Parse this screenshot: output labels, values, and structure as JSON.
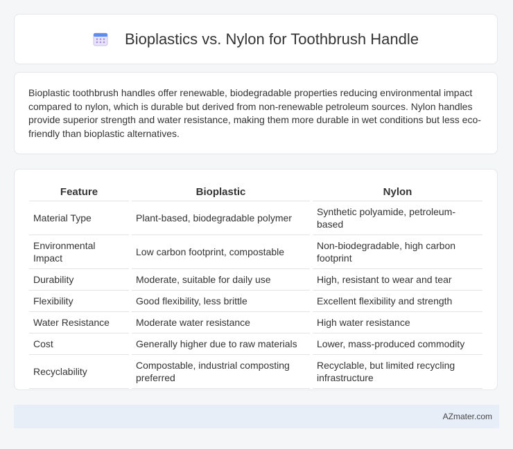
{
  "header": {
    "title": "Bioplastics vs. Nylon for Toothbrush Handle",
    "icon": "calendar-icon"
  },
  "summary": {
    "text": "Bioplastic toothbrush handles offer renewable, biodegradable properties reducing environmental impact compared to nylon, which is durable but derived from non-renewable petroleum sources. Nylon handles provide superior strength and water resistance, making them more durable in wet conditions but less eco-friendly than bioplastic alternatives."
  },
  "table": {
    "headers": [
      "Feature",
      "Bioplastic",
      "Nylon"
    ],
    "rows": [
      [
        "Material Type",
        "Plant-based, biodegradable polymer",
        "Synthetic polyamide, petroleum-based"
      ],
      [
        "Environmental Impact",
        "Low carbon footprint, compostable",
        "Non-biodegradable, high carbon footprint"
      ],
      [
        "Durability",
        "Moderate, suitable for daily use",
        "High, resistant to wear and tear"
      ],
      [
        "Flexibility",
        "Good flexibility, less brittle",
        "Excellent flexibility and strength"
      ],
      [
        "Water Resistance",
        "Moderate water resistance",
        "High water resistance"
      ],
      [
        "Cost",
        "Generally higher due to raw materials",
        "Lower, mass-produced commodity"
      ],
      [
        "Recyclability",
        "Compostable, industrial composting preferred",
        "Recyclable, but limited recycling infrastructure"
      ]
    ]
  },
  "footer": {
    "brand": "AZmater.com"
  }
}
